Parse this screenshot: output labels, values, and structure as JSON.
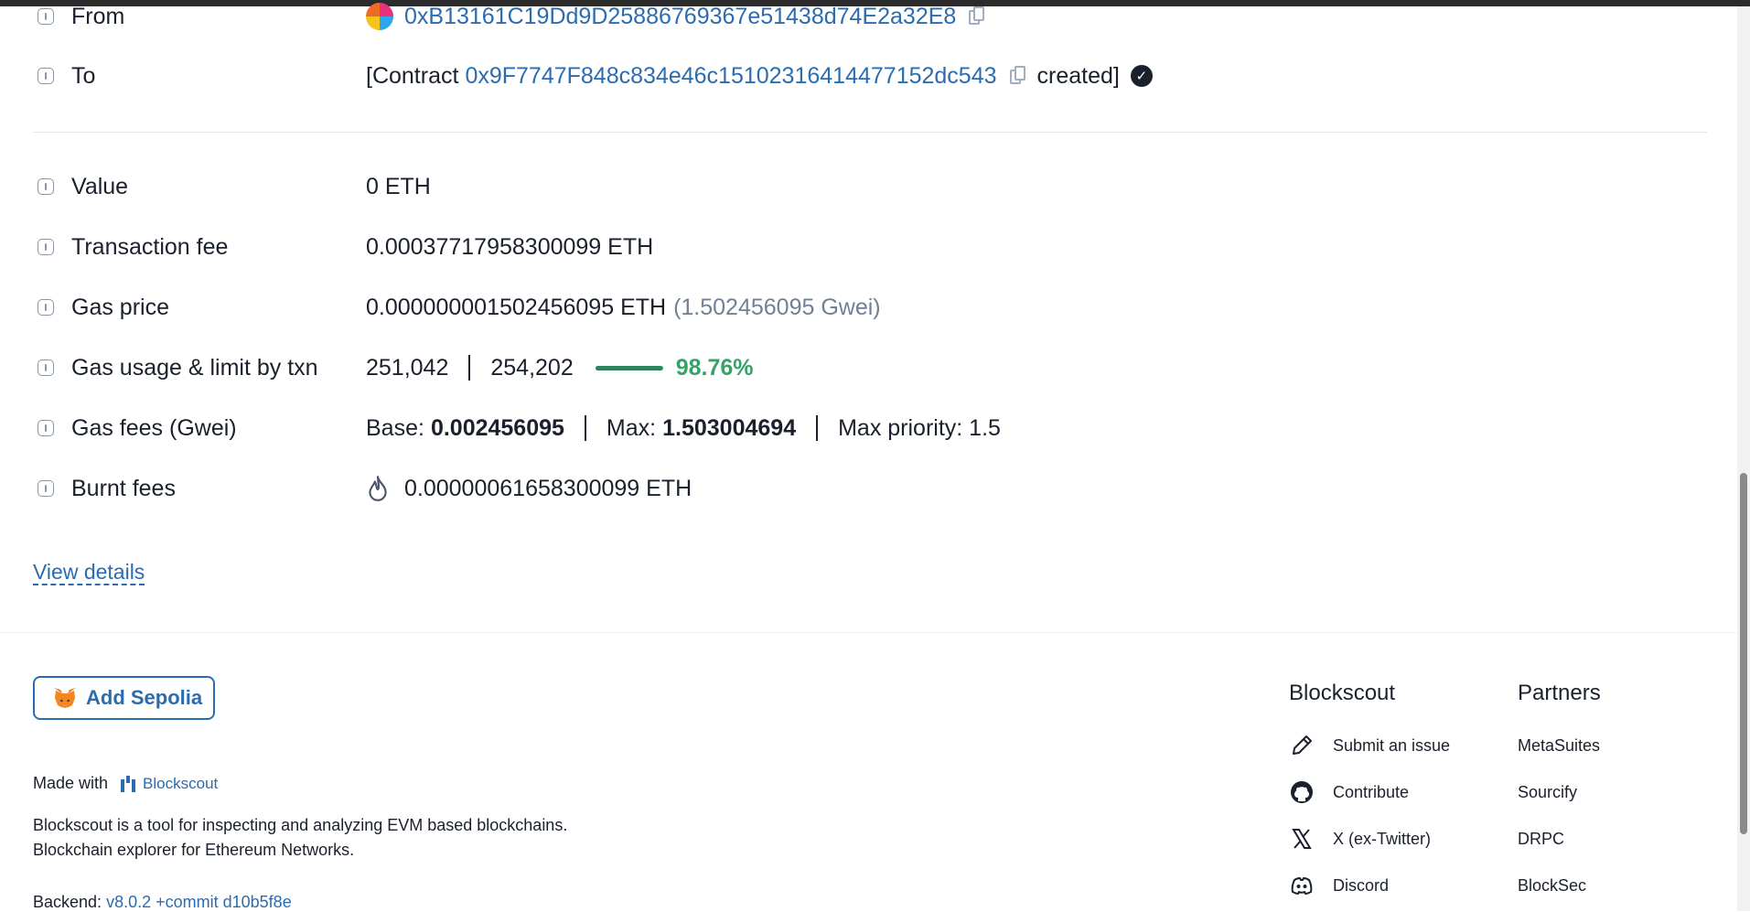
{
  "details": {
    "from": {
      "label": "From",
      "address": "0xB13161C19Dd9D25886769367e51438d74E2a32E8"
    },
    "to": {
      "label": "To",
      "prefix": "[Contract",
      "address": "0x9F7747F848c834e46c15102316414477152dc543",
      "suffix": "created]"
    },
    "value": {
      "label": "Value",
      "text": "0 ETH"
    },
    "transaction_fee": {
      "label": "Transaction fee",
      "text": "0.00037717958300099 ETH"
    },
    "gas_price": {
      "label": "Gas price",
      "text": "0.000000001502456095 ETH",
      "gwei": "(1.502456095 Gwei)"
    },
    "gas_usage": {
      "label": "Gas usage & limit by txn",
      "used": "251,042",
      "limit": "254,202",
      "percent": "98.76%",
      "fraction": 0.9876
    },
    "gas_fees": {
      "label": "Gas fees (Gwei)",
      "base_label": "Base:",
      "base": "0.002456095",
      "max_label": "Max:",
      "max": "1.503004694",
      "priority": "Max priority: 1.5"
    },
    "burnt_fees": {
      "label": "Burnt fees",
      "text": "0.00000061658300099 ETH"
    },
    "view_details": "View details"
  },
  "footer": {
    "add_network": "Add Sepolia",
    "made_with": "Made with",
    "made_with_brand": "Blockscout",
    "description_line1": "Blockscout is a tool for inspecting and analyzing EVM based blockchains.",
    "description_line2": "Blockchain explorer for Ethereum Networks.",
    "backend_label": "Backend:",
    "backend_version": "v8.0.2 +commit d10b5f8e",
    "blockscout_title": "Blockscout",
    "blockscout_links": [
      "Submit an issue",
      "Contribute",
      "X (ex-Twitter)",
      "Discord"
    ],
    "partners_title": "Partners",
    "partners_links": [
      "MetaSuites",
      "Sourcify",
      "DRPC",
      "BlockSec"
    ]
  },
  "colors": {
    "link": "#2b6cb0",
    "success": "#38a169",
    "text": "#1a202c",
    "muted": "#718096"
  },
  "icons": {
    "info": "info-icon",
    "copy": "copy-icon",
    "verified": "check-circle-icon",
    "burnt": "flame-icon",
    "metamask": "metamask-fox-icon",
    "submit_issue": "pencil-icon",
    "contribute": "github-icon",
    "twitter": "x-icon",
    "discord": "discord-icon"
  }
}
